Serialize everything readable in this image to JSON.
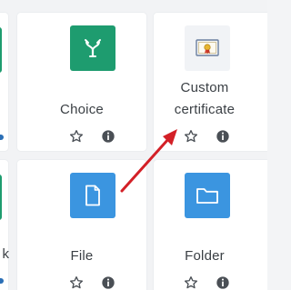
{
  "cards": {
    "choice": {
      "label": "Choice",
      "icon": "choice-fork-icon",
      "color": "#1e9c6f"
    },
    "custom_certificate": {
      "label_line1": "Custom",
      "label_line2": "certificate",
      "icon": "certificate-icon",
      "color": "#f1f3f6"
    },
    "file": {
      "label": "File",
      "icon": "document-icon",
      "color": "#3b95e0"
    },
    "folder": {
      "label": "Folder",
      "icon": "folder-icon",
      "color": "#3b95e0"
    },
    "partial_left_bottom": {
      "label_fragment": "k"
    }
  },
  "actions": {
    "star_icon": "star-outline-icon",
    "info_icon": "info-icon"
  },
  "annotation": {
    "arrow_color": "#d32027"
  }
}
